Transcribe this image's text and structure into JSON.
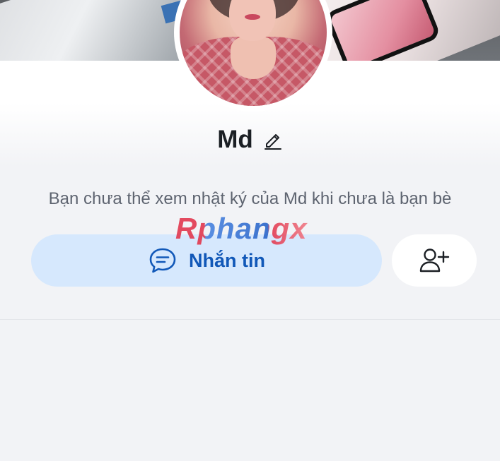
{
  "profile": {
    "name": "Md",
    "friend_notice": "Bạn chưa thể xem nhật ký của Md khi chưa là bạn bè"
  },
  "actions": {
    "message_label": "Nhắn tin",
    "message_icon": "chat-bubble-icon",
    "add_friend_icon": "add-friend-icon",
    "edit_icon": "pencil-icon"
  },
  "watermark": {
    "text": "Rphangx"
  },
  "colors": {
    "accent": "#1158b8",
    "message_button_bg": "#d6e8fd",
    "page_bg": "#f2f3f6"
  }
}
